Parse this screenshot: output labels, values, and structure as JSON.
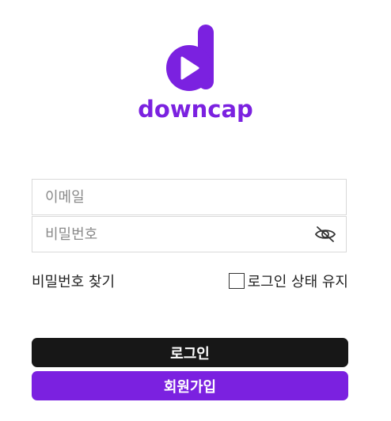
{
  "brand": {
    "name": "downcap",
    "color": "#7b21e0",
    "logo_icon": "play-d-logo-icon"
  },
  "form": {
    "email_placeholder": "이메일",
    "password_placeholder": "비밀번호",
    "password_toggle_icon": "eye-off-icon"
  },
  "options": {
    "find_password": "비밀번호 찾기",
    "keep_login": "로그인 상태 유지",
    "keep_login_checked": false
  },
  "buttons": {
    "login": "로그인",
    "signup": "회원가입",
    "login_color": "#171717",
    "signup_color": "#7b21e0"
  }
}
